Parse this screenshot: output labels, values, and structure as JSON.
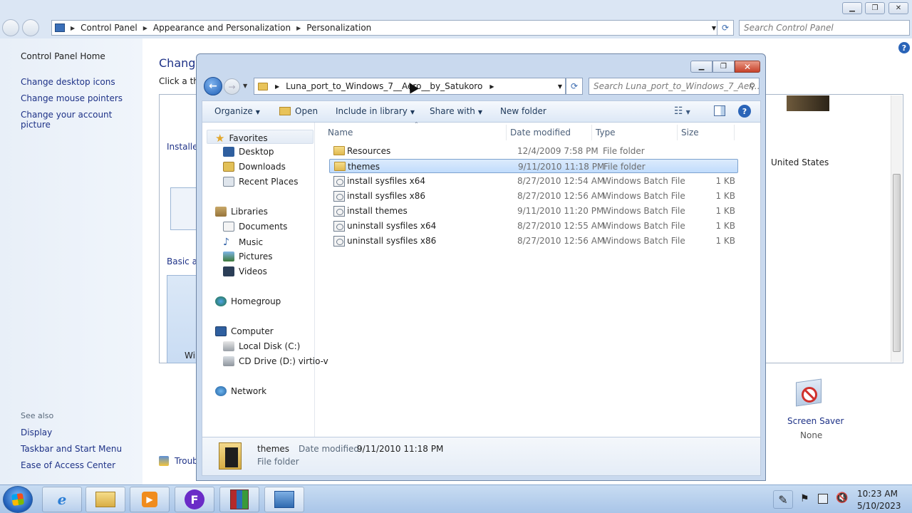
{
  "control_panel": {
    "breadcrumb": [
      "Control Panel",
      "Appearance and Personalization",
      "Personalization"
    ],
    "search_placeholder": "Search Control Panel",
    "left_links": [
      "Control Panel Home",
      "Change desktop icons",
      "Change mouse pointers",
      "Change your account picture"
    ],
    "see_also_label": "See also",
    "see_also_links": [
      "Display",
      "Taskbar and Start Menu",
      "Ease of Access Center"
    ],
    "main_title": "Change",
    "main_subtitle": "Click a the",
    "installed_label": "Installed",
    "basic_label": "Basic ar",
    "theme_partial_label": "Wir",
    "country_label": "United States",
    "screen_saver_label": "Screen Saver",
    "screen_saver_value": "None",
    "troubleshoot_partial": "Troub"
  },
  "explorer": {
    "breadcrumb": [
      "Luna_port_to_Windows_7__Aero__by_Satukoro"
    ],
    "search_placeholder": "Search Luna_port_to_Windows_7_Aer...",
    "toolbar": {
      "organize": "Organize",
      "open": "Open",
      "include_in_library": "Include in library",
      "share_with": "Share with",
      "new_folder": "New folder"
    },
    "nav": {
      "favorites": "Favorites",
      "desktop": "Desktop",
      "downloads": "Downloads",
      "recent_places": "Recent Places",
      "libraries": "Libraries",
      "documents": "Documents",
      "music": "Music",
      "pictures": "Pictures",
      "videos": "Videos",
      "homegroup": "Homegroup",
      "computer": "Computer",
      "local_disk": "Local Disk (C:)",
      "cd_drive": "CD Drive (D:) virtio-v",
      "network": "Network"
    },
    "columns": {
      "name": "Name",
      "date_modified": "Date modified",
      "type": "Type",
      "size": "Size"
    },
    "files": [
      {
        "name": "Resources",
        "date": "12/4/2009 7:58 PM",
        "type": "File folder",
        "size": "",
        "icon": "folder-icon",
        "selected": false
      },
      {
        "name": "themes",
        "date": "9/11/2010 11:18 PM",
        "type": "File folder",
        "size": "",
        "icon": "folder-icon",
        "selected": true
      },
      {
        "name": "install sysfiles x64",
        "date": "8/27/2010 12:54 AM",
        "type": "Windows Batch File",
        "size": "1 KB",
        "icon": "batch-file-icon",
        "selected": false
      },
      {
        "name": "install sysfiles x86",
        "date": "8/27/2010 12:56 AM",
        "type": "Windows Batch File",
        "size": "1 KB",
        "icon": "batch-file-icon",
        "selected": false
      },
      {
        "name": "install themes",
        "date": "9/11/2010 11:20 PM",
        "type": "Windows Batch File",
        "size": "1 KB",
        "icon": "batch-file-icon",
        "selected": false
      },
      {
        "name": "uninstall sysfiles x64",
        "date": "8/27/2010 12:55 AM",
        "type": "Windows Batch File",
        "size": "1 KB",
        "icon": "batch-file-icon",
        "selected": false
      },
      {
        "name": "uninstall sysfiles x86",
        "date": "8/27/2010 12:56 AM",
        "type": "Windows Batch File",
        "size": "1 KB",
        "icon": "batch-file-icon",
        "selected": false
      }
    ],
    "details": {
      "name": "themes",
      "date_label": "Date modified:",
      "date_value": "9/11/2010 11:18 PM",
      "type": "File folder"
    }
  },
  "taskbar": {
    "time": "10:23 AM",
    "date": "5/10/2023",
    "apps": [
      "internet-explorer-icon",
      "file-explorer-icon",
      "media-player-icon",
      "app-f-icon",
      "winrar-icon",
      "control-panel-icon"
    ]
  },
  "colors": {
    "link": "#1e3287",
    "selection": "#c1dcfc",
    "taskbar": "#a9c5e8",
    "close_button": "#c7422a"
  }
}
